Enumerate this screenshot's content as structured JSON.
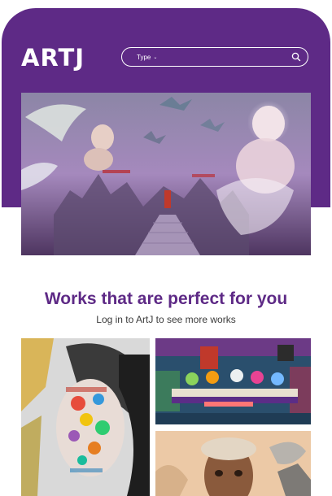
{
  "header": {
    "logo_text": "ARTJ",
    "brand_color": "#5e2a86",
    "search": {
      "type_label": "Type",
      "type_caret": "⌄",
      "search_icon": "search-icon"
    }
  },
  "hero": {
    "artwork": "hero-artwork-image"
  },
  "section": {
    "title": "Works that are perfect for you",
    "subtitle": "Log in to ArtJ to see more works"
  },
  "gallery": {
    "items": [
      {
        "name": "artwork-face-collage"
      },
      {
        "name": "artwork-banquet-scene"
      },
      {
        "name": "artwork-portrait"
      }
    ]
  }
}
